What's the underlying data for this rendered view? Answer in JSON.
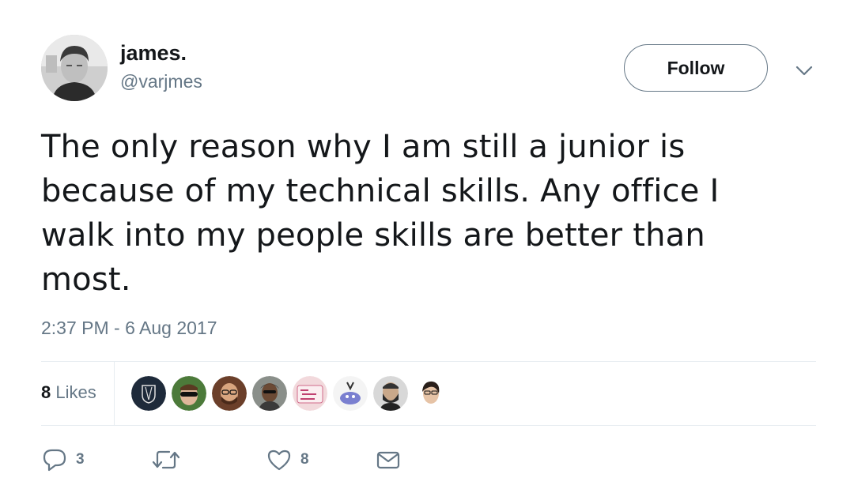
{
  "user": {
    "display_name": "james.",
    "handle": "@varjmes"
  },
  "follow_button": {
    "label": "Follow"
  },
  "menu": {
    "icon": "chevron-down-icon"
  },
  "tweet": {
    "text": "The only reason why I am still a junior is because of my technical skills. Any office I walk into my people skills are better than most.",
    "timestamp": "2:37 PM - 6 Aug 2017"
  },
  "stats": {
    "likes_count": "8",
    "likes_label": "Likes"
  },
  "likers": [
    {
      "icon": "avatar-emblem"
    },
    {
      "icon": "avatar-sunglasses"
    },
    {
      "icon": "avatar-glasses-beard"
    },
    {
      "icon": "avatar-outdoor"
    },
    {
      "icon": "avatar-sign"
    },
    {
      "icon": "avatar-cartoon"
    },
    {
      "icon": "avatar-beard"
    },
    {
      "icon": "avatar-woman"
    }
  ],
  "actions": {
    "reply_count": "3",
    "retweet_count": "",
    "like_count": "8"
  },
  "colors": {
    "text": "#14171a",
    "secondary": "#657786",
    "divider": "#e6ecf0"
  }
}
